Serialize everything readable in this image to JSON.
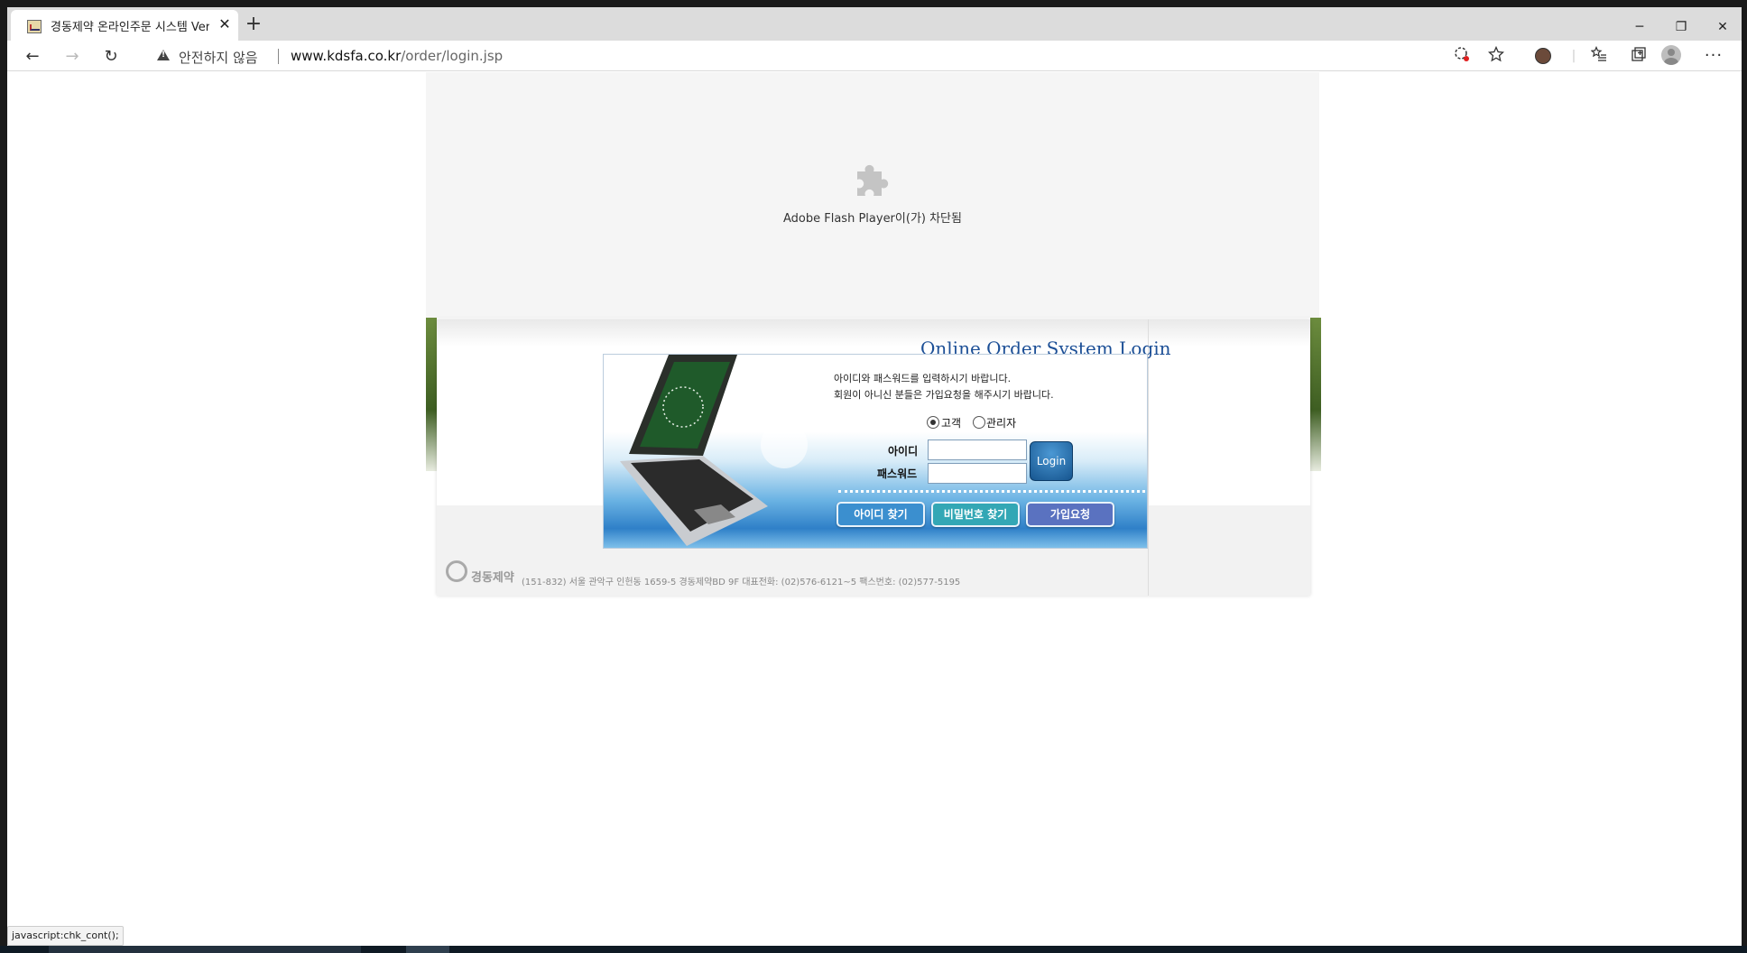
{
  "browser": {
    "tab_title": "경동제약 온라인주문 시스템 Ver",
    "tab_close": "✕",
    "new_tab": "+",
    "window_controls": {
      "minimize": "─",
      "restore": "❐",
      "close": "✕"
    },
    "toolbar": {
      "back": "←",
      "forward": "→",
      "refresh": "↻"
    },
    "security_text": "안전하지 않음",
    "url_host": "www.kdsfa.co.kr",
    "url_path": "/order/login.jsp",
    "icons": [
      "tracking-prevention-icon",
      "favorite-star-icon",
      "extension-avatar-icon",
      "favorites-list-icon",
      "collections-icon",
      "profile-icon",
      "more-menu-icon"
    ]
  },
  "flash": {
    "message": "Adobe Flash Player이(가) 차단됨"
  },
  "login": {
    "heading": "Online Order System Login",
    "instruction_1": "아이디와 패스워드를 입력하시기 바랍니다.",
    "instruction_2": "회원이 아니신 분들은 가입요청을 해주시기 바랍니다.",
    "role_options": [
      {
        "label": "고객",
        "selected": true
      },
      {
        "label": "관리자",
        "selected": false
      }
    ],
    "id_label": "아이디",
    "password_label": "패스워드",
    "id_value": "",
    "password_value": "",
    "login_button": "Login",
    "find_id_button": "아이디 찾기",
    "find_password_button": "비밀번호 찾기",
    "join_button": "가입요청"
  },
  "footer": {
    "company_logo_text": "경동제약",
    "address": "(151-832) 서울 관악구 인헌동 1659-5 경동제약BD 9F 대표전화: (02)576-6121~5 팩스번호: (02)577-5195"
  },
  "status_bar": {
    "text": "javascript:chk_cont();"
  },
  "colors": {
    "heading": "#1c4f96",
    "login_button": "#16558f",
    "find_id_button": "#3b8fcf",
    "find_password_button": "#33a7b5",
    "join_button": "#5a72c0"
  }
}
